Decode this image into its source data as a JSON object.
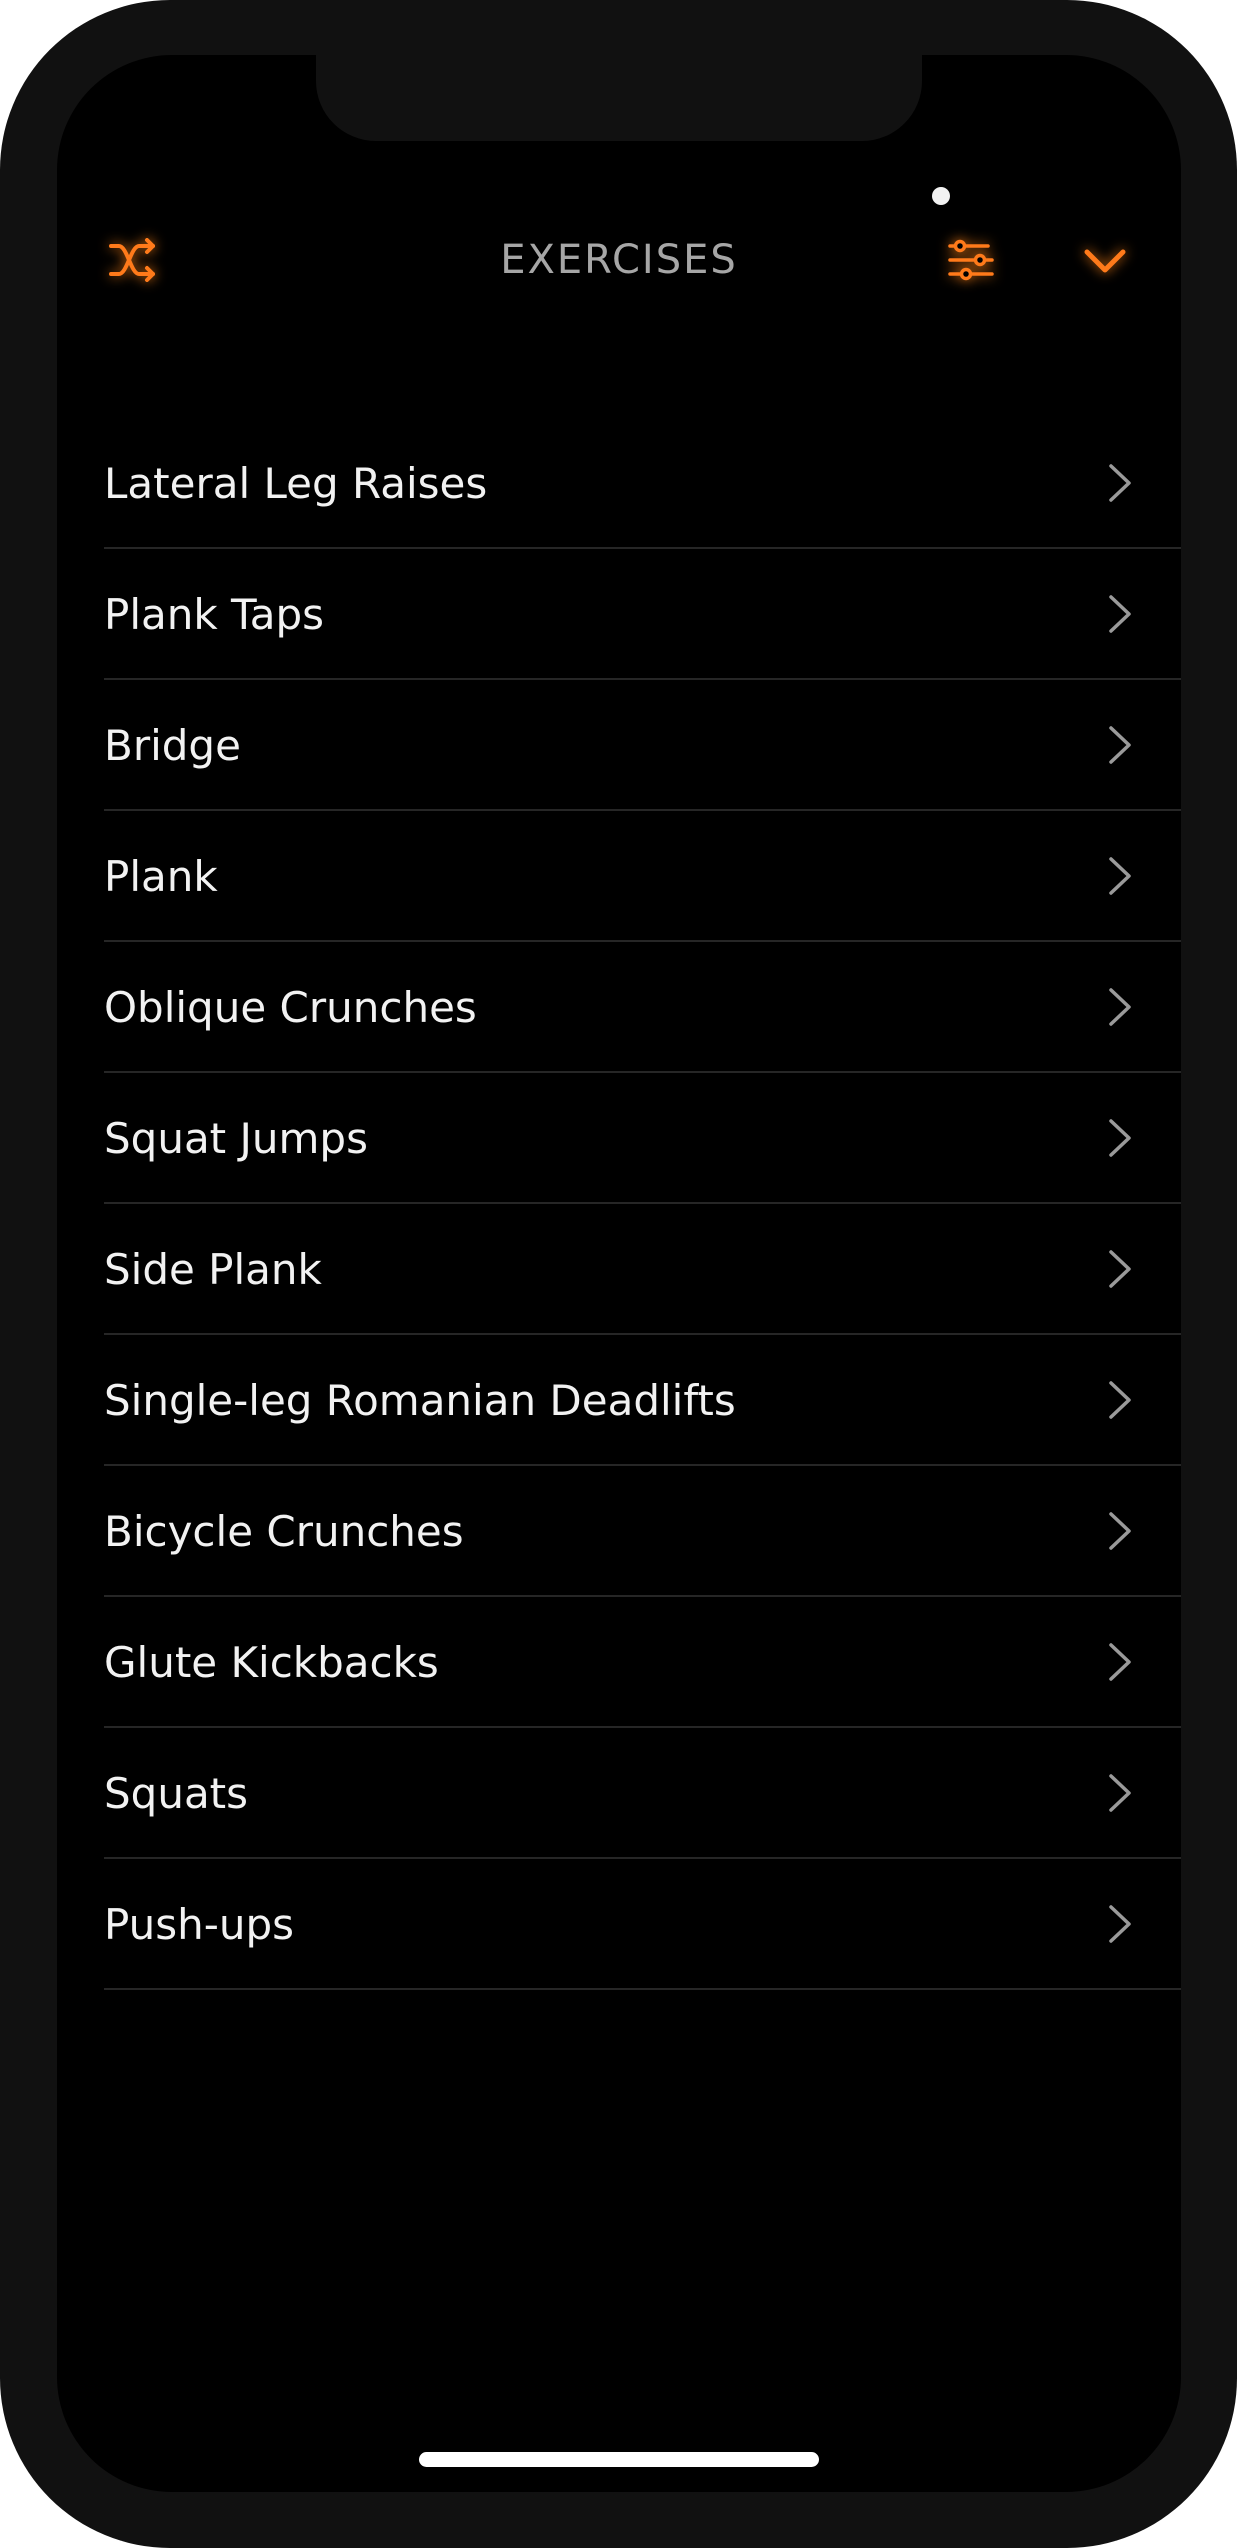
{
  "header": {
    "title": "EXERCISES",
    "left_icon": "shuffle-icon",
    "filter_icon": "sliders-filter-icon",
    "right_icon": "chevron-down-icon",
    "accent_color": "#ff7a1a"
  },
  "exercises": [
    {
      "label": "Lateral Leg Raises"
    },
    {
      "label": "Plank Taps"
    },
    {
      "label": "Bridge"
    },
    {
      "label": "Plank"
    },
    {
      "label": "Oblique Crunches"
    },
    {
      "label": "Squat Jumps"
    },
    {
      "label": "Side Plank"
    },
    {
      "label": "Single-leg Romanian Deadlifts"
    },
    {
      "label": "Bicycle Crunches"
    },
    {
      "label": "Glute Kickbacks"
    },
    {
      "label": "Squats"
    },
    {
      "label": "Push-ups"
    }
  ],
  "row_icon": "chevron-right-icon"
}
